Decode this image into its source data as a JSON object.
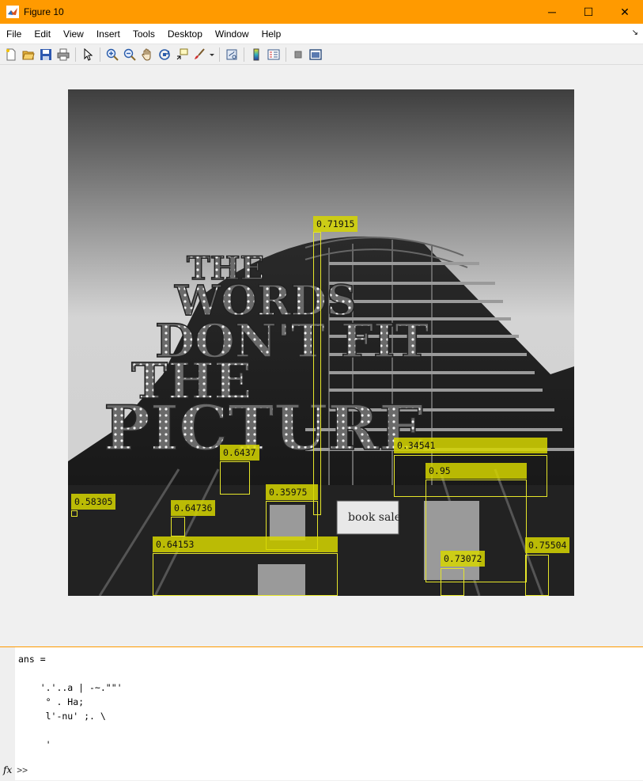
{
  "window": {
    "title": "Figure 10",
    "minimize": "─",
    "maximize": "☐",
    "close": "✕"
  },
  "menu": [
    "File",
    "Edit",
    "View",
    "Insert",
    "Tools",
    "Desktop",
    "Window",
    "Help"
  ],
  "toolbar": {
    "icons": [
      "new-figure-icon",
      "open-file-icon",
      "save-icon",
      "print-icon",
      "select-arrow-icon",
      "zoom-in-icon",
      "zoom-out-icon",
      "pan-hand-icon",
      "rotate-3d-icon",
      "data-cursor-icon",
      "brush-icon",
      "link-plot-icon",
      "colorbar-icon",
      "legend-icon",
      "hide-plot-tools-icon",
      "show-plot-tools-icon"
    ]
  },
  "image": {
    "sign_text": [
      "THE",
      "WORDS",
      "DON'T FIT",
      "THE",
      "PICTURE"
    ],
    "banner_text": "book sale"
  },
  "detections": [
    {
      "score": "0.71915"
    },
    {
      "score": "0.6437"
    },
    {
      "score": "0.34541"
    },
    {
      "score": "0.95"
    },
    {
      "score": "0.58305"
    },
    {
      "score": "0.35975"
    },
    {
      "score": "0.64736"
    },
    {
      "score": "0.64153"
    },
    {
      "score": "0.73072"
    },
    {
      "score": "0.75504"
    }
  ],
  "command_window": {
    "output": "ans =\n\n    '.'..a | -~.\"\"'\n     ° . Ha;\n     l'-nu' ;. \\\n\n     '",
    "prompt": ">>"
  },
  "colors": {
    "titlebar": "#ff9a00",
    "box_stroke": "#e6e62a",
    "label_fill": "#d6d600"
  }
}
